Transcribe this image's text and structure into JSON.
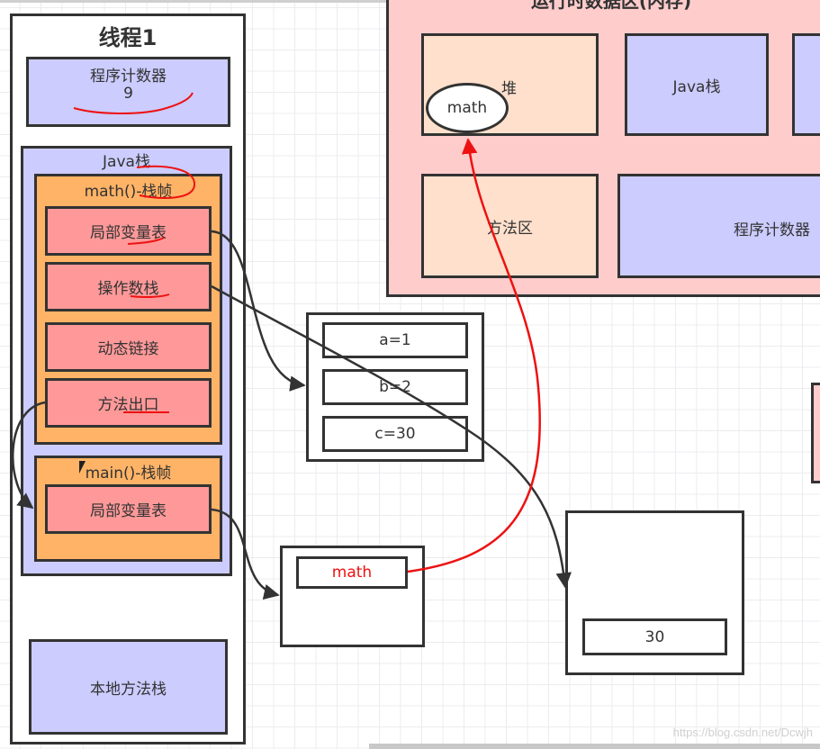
{
  "thread": {
    "title": "线程1",
    "pc": {
      "label": "程序计数器",
      "value": "9"
    },
    "java_stack": {
      "label": "Java栈",
      "frames": [
        {
          "label": "math()-栈帧",
          "items": [
            "局部变量表",
            "操作数栈",
            "动态链接",
            "方法出口"
          ]
        },
        {
          "label": "main()-栈帧",
          "items": [
            "局部变量表"
          ]
        }
      ]
    },
    "native_stack": "本地方法栈"
  },
  "runtime_area": {
    "title": "运行时数据区(内存)",
    "heap": {
      "label": "堆",
      "object": "math"
    },
    "java_stack": "Java栈",
    "method_area": "方法区",
    "pc": "程序计数器"
  },
  "local_vars": [
    "a=1",
    "b=2",
    "c=30"
  ],
  "main_locals": {
    "var": "math"
  },
  "operand_box": {
    "value": "30"
  },
  "watermark": "https://blog.csdn.net/Dcwjh",
  "colors": {
    "thread_bg": "#ffffff",
    "pc_bg": "#ccccff",
    "frame_bg": "#ffb366",
    "item_bg": "#ff9999",
    "runtime_bg": "#ffcccc",
    "heap_bg": "#ffe0cc",
    "annotation_red": "#ee1111"
  }
}
